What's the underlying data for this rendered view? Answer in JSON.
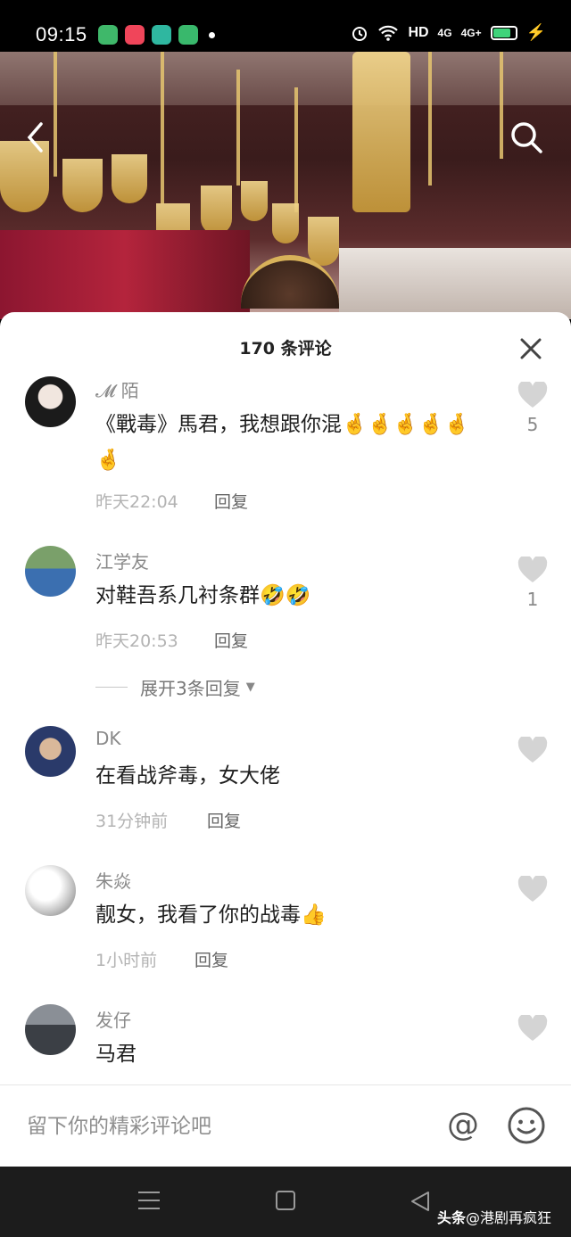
{
  "status_bar": {
    "time": "09:15",
    "network_label": "HD",
    "signal_1": "4G",
    "signal_2": "4G+",
    "app_icon_colors": [
      "#3fb86a",
      "#f0455a",
      "#2fb7a0",
      "#39b86c"
    ],
    "battery_color": "#3fd37a"
  },
  "header": {
    "back_icon": "chevron-left-icon",
    "search_icon": "search-icon"
  },
  "sheet": {
    "title": "170 条评论",
    "close_icon": "close-icon"
  },
  "comments": [
    {
      "name": "𝓜 陌",
      "text": "《戰毒》馬君，我想跟你混🤞🤞🤞🤞🤞🤞",
      "time": "昨天22:04",
      "reply": "回复",
      "likes": "5"
    },
    {
      "name": "江学友",
      "text": "对鞋吾系几衬条群🤣🤣",
      "time": "昨天20:53",
      "reply": "回复",
      "likes": "1",
      "expand": "展开3条回复"
    },
    {
      "name": "DK",
      "text": "在看战斧毒，女大佬",
      "time": "31分钟前",
      "reply": "回复",
      "likes": ""
    },
    {
      "name": "朱焱",
      "text": "靓女，我看了你的战毒👍",
      "time": "1小时前",
      "reply": "回复",
      "likes": ""
    },
    {
      "name": "发仔",
      "text": "马君",
      "time": "",
      "reply": "",
      "likes": ""
    }
  ],
  "input_bar": {
    "placeholder": "留下你的精彩评论吧",
    "at_symbol": "@",
    "at_icon": "at-icon",
    "emoji_icon": "smiley-icon"
  },
  "nav_bar": {
    "icons": [
      "menu-icon",
      "home-icon",
      "back-triangle-icon"
    ]
  },
  "watermark": {
    "brand": "头条",
    "handle": "@港剧再疯狂"
  }
}
